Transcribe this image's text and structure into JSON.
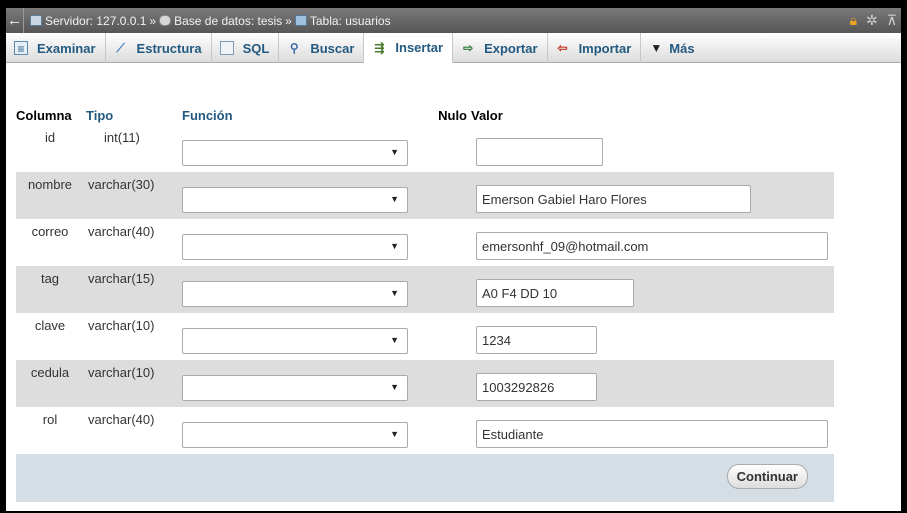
{
  "titlebar": {
    "back_icon": "arrow-left-icon",
    "server_label": "Servidor: 127.0.0.1",
    "db_label": "Base de datos: tesis",
    "table_label": "Tabla: usuarios",
    "separator": "»"
  },
  "tabs": [
    {
      "label": "Examinar",
      "icon": "browse-icon"
    },
    {
      "label": "Estructura",
      "icon": "structure-icon"
    },
    {
      "label": "SQL",
      "icon": "sql-icon"
    },
    {
      "label": "Buscar",
      "icon": "search-icon"
    },
    {
      "label": "Insertar",
      "icon": "insert-icon",
      "active": true
    },
    {
      "label": "Exportar",
      "icon": "export-icon"
    },
    {
      "label": "Importar",
      "icon": "import-icon"
    },
    {
      "label": "Más",
      "icon": "dropdown-triangle-icon"
    }
  ],
  "table": {
    "headers": {
      "column": "Columna",
      "type": "Tipo",
      "function": "Función",
      "null": "Nulo",
      "value": "Valor"
    },
    "rows": [
      {
        "name": "id",
        "type": "int(11)",
        "value": ""
      },
      {
        "name": "nombre",
        "type": "varchar(30)",
        "value": "Emerson Gabiel Haro Flores"
      },
      {
        "name": "correo",
        "type": "varchar(40)",
        "value": "emersonhf_09@hotmail.com"
      },
      {
        "name": "tag",
        "type": "varchar(15)",
        "value": "A0 F4 DD 10"
      },
      {
        "name": "clave",
        "type": "varchar(10)",
        "value": "1234"
      },
      {
        "name": "cedula",
        "type": "varchar(10)",
        "value": "1003292826"
      },
      {
        "name": "rol",
        "type": "varchar(40)",
        "value": "Estudiante"
      }
    ]
  },
  "footer": {
    "submit_label": "Continuar"
  },
  "colors": {
    "link_blue": "#235a81",
    "row_alt": "#dddddd",
    "footer_bg": "#d5dde5"
  }
}
